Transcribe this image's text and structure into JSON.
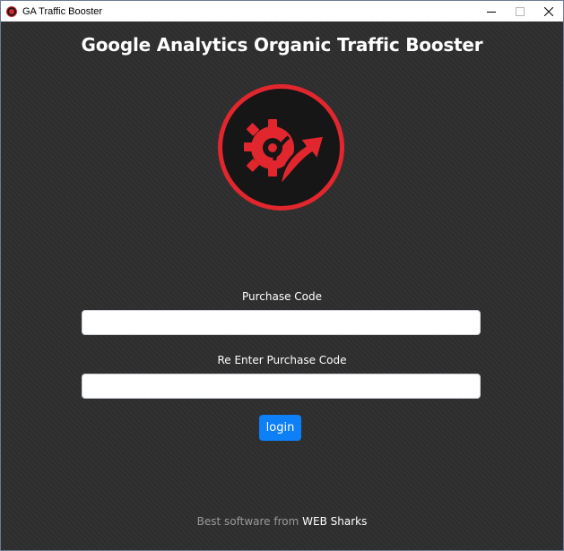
{
  "window": {
    "title": "GA Traffic Booster",
    "icon": "app-logo-icon"
  },
  "colors": {
    "accent_red": "#e1272d",
    "button_blue": "#0d7ff7",
    "background": "#2f2f2f"
  },
  "main": {
    "heading": "Google Analytics Organic Traffic Booster",
    "logo_icon": "gear-arrow-logo-icon"
  },
  "form": {
    "purchase_code": {
      "label": "Purchase Code",
      "value": "",
      "placeholder": ""
    },
    "reenter_purchase_code": {
      "label": "Re Enter Purchase Code",
      "value": "",
      "placeholder": ""
    },
    "login_label": "login"
  },
  "footer": {
    "prefix": "Best software from",
    "brand": "WEB Sharks"
  }
}
